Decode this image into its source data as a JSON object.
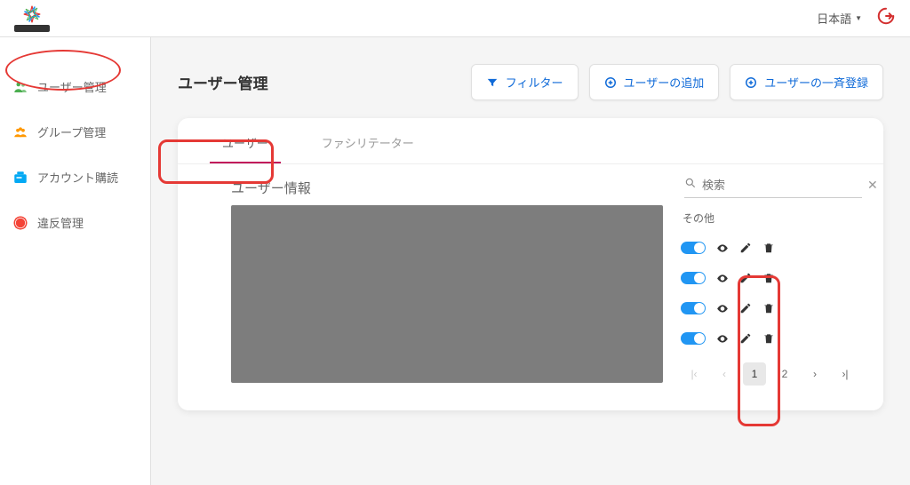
{
  "header": {
    "language_label": "日本語"
  },
  "sidebar": {
    "items": [
      {
        "label": "ユーザー管理",
        "icon": "users-icon",
        "color": "#4caf50"
      },
      {
        "label": "グループ管理",
        "icon": "group-icon",
        "color": "#ff9800"
      },
      {
        "label": "アカウント購読",
        "icon": "subscription-icon",
        "color": "#03a9f4"
      },
      {
        "label": "違反管理",
        "icon": "violation-icon",
        "color": "#f44336"
      }
    ]
  },
  "main": {
    "title": "ユーザー管理",
    "buttons": {
      "filter": "フィルター",
      "add_user": "ユーザーの追加",
      "bulk_register": "ユーザーの一斉登録"
    },
    "tabs": [
      {
        "label": "ユーザー",
        "active": true
      },
      {
        "label": "ファシリテーター",
        "active": false
      }
    ],
    "card": {
      "subtitle": "ユーザー情報",
      "search_placeholder": "検索",
      "other_column": "その他",
      "row_count": 4
    },
    "pagination": {
      "current": "1",
      "next": "2"
    }
  }
}
